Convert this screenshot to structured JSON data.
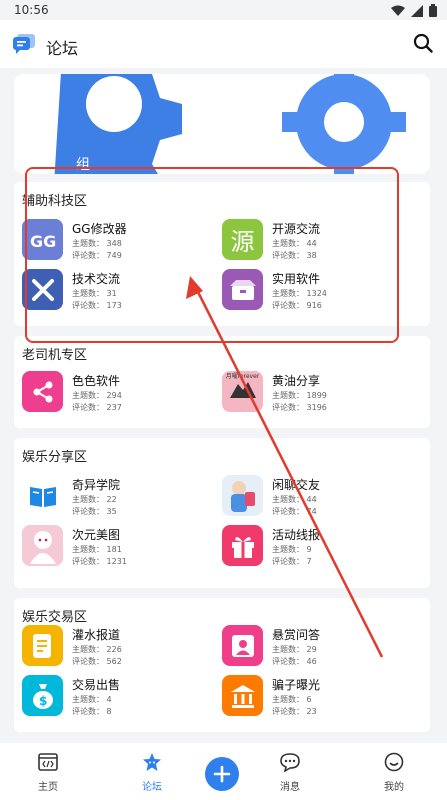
{
  "status_bar": {
    "time": "10:56"
  },
  "header": {
    "title": "论坛"
  },
  "banner": {
    "text": "组"
  },
  "sections": [
    {
      "title": "辅助科技区",
      "items": [
        {
          "name": "GG修改器",
          "topics": "主题数： 348",
          "comments": "评论数： 749",
          "icon": "gg-modifier-icon",
          "color": "#5b6fc7"
        },
        {
          "name": "开源交流",
          "topics": "主题数： 44",
          "comments": "评论数： 38",
          "icon": "source-char-icon",
          "color": "#8cc63f"
        },
        {
          "name": "技术交流",
          "topics": "主题数： 31",
          "comments": "评论数： 173",
          "icon": "tools-icon",
          "color": "#3f5fb5"
        },
        {
          "name": "实用软件",
          "topics": "主题数： 1324",
          "comments": "评论数： 916",
          "icon": "box-icon",
          "color": "#9b59b6"
        }
      ]
    },
    {
      "title": "老司机专区",
      "items": [
        {
          "name": "色色软件",
          "topics": "主题数： 294",
          "comments": "评论数： 237",
          "icon": "share-icon",
          "color": "#ee3f8f"
        },
        {
          "name": "黄油分享",
          "topics": "主题数： 1899",
          "comments": "评论数： 3196",
          "icon": "anime-cover-icon",
          "color": "#f4b6c2",
          "icon_text": "月曜forever"
        }
      ]
    },
    {
      "title": "娱乐分享区",
      "items": [
        {
          "name": "奇异学院",
          "topics": "主题数： 22",
          "comments": "评论数： 35",
          "icon": "book-icon",
          "color": "#1e88e5"
        },
        {
          "name": "闲聊交友",
          "topics": "主题数： 44",
          "comments": "评论数： 74",
          "icon": "chat-character-icon",
          "color": "#e6eef8"
        },
        {
          "name": "次元美图",
          "topics": "主题数： 181",
          "comments": "评论数： 1231",
          "icon": "anime-girl-icon",
          "color": "#f5c9d6"
        },
        {
          "name": "活动线报",
          "topics": "主题数： 9",
          "comments": "评论数： 7",
          "icon": "gift-icon",
          "color": "#f03a6b"
        }
      ]
    },
    {
      "title": "娱乐交易区",
      "items": [
        {
          "name": "灌水报道",
          "topics": "主题数： 226",
          "comments": "评论数： 562",
          "icon": "document-icon",
          "color": "#f5b400"
        },
        {
          "name": "悬赏问答",
          "topics": "主题数： 29",
          "comments": "评论数： 46",
          "icon": "question-user-icon",
          "color": "#ef3e8a"
        },
        {
          "name": "交易出售",
          "topics": "主题数： 4",
          "comments": "评论数： 8",
          "icon": "money-bag-icon",
          "color": "#00b8d9"
        },
        {
          "name": "骗子曝光",
          "topics": "主题数： 6",
          "comments": "评论数： 23",
          "icon": "bank-icon",
          "color": "#ff7a00"
        }
      ]
    }
  ],
  "bottom_nav": [
    {
      "label": "主页",
      "icon": "code-window-icon"
    },
    {
      "label": "论坛",
      "icon": "forum-star-icon",
      "active": true
    },
    {
      "label": "消息",
      "icon": "message-icon"
    },
    {
      "label": "我的",
      "icon": "smile-icon"
    }
  ],
  "colors": {
    "accent": "#2f80ed",
    "annotation": "#e23b2e"
  }
}
